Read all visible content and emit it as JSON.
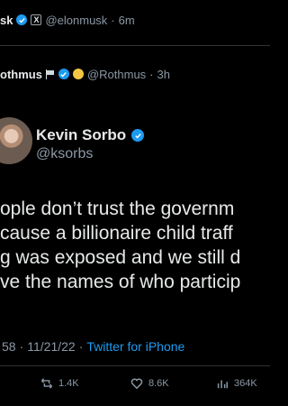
{
  "header_tweet": {
    "name": "sk",
    "handle": "@elonmusk",
    "time": "6m",
    "separator": "·"
  },
  "quoted_author": {
    "name": "othmus",
    "handle": "@Rothmus",
    "time": "3h",
    "separator": "·"
  },
  "main_tweet": {
    "author_name": "Kevin Sorbo",
    "author_handle": "@ksorbs",
    "text": "ople don’t trust the governm\ncause a billionaire child traff\ng was exposed and we still d\nve the names of who particip",
    "time_fragment": "58",
    "date": "11/21/22",
    "separator": "·",
    "source": "Twitter for iPhone"
  },
  "actions": {
    "retweets": "1.4K",
    "likes": "8.6K",
    "views": "364K"
  },
  "colors": {
    "background": "#000000",
    "accent": "#1d9bf0",
    "muted": "#8b98a5",
    "text": "#e7e9ea",
    "divider": "#2f3336"
  }
}
